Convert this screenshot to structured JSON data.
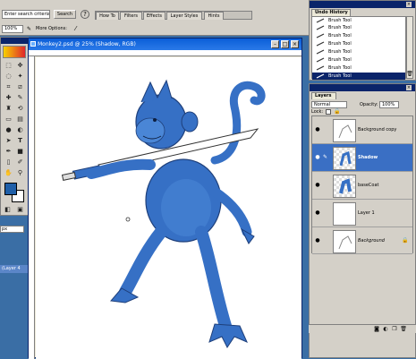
{
  "options_bar": {
    "search_placeholder": "Enter search criteria",
    "search_button": "Search",
    "more_options_label": "More Options:",
    "tabs": [
      "How To",
      "Filters",
      "Effects",
      "Layer Styles",
      "Hints"
    ],
    "zoom": "100%"
  },
  "document": {
    "title": "Monkey2.psd @ 25% (Shadow, RGB)",
    "accent_color": "#3670c5"
  },
  "undo_history": {
    "title": "Undo History",
    "items": [
      "Brush Tool",
      "Brush Tool",
      "Brush Tool",
      "Brush Tool",
      "Brush Tool",
      "Brush Tool",
      "Brush Tool",
      "Brush Tool"
    ],
    "selected_index": 7
  },
  "layers": {
    "title": "Layers",
    "blend_mode": "Normal",
    "opacity_label": "Opacity:",
    "opacity_value": "100%",
    "lock_label": "Lock:",
    "items": [
      {
        "name": "Background copy",
        "italic": false
      },
      {
        "name": "Shadow",
        "italic": false
      },
      {
        "name": "baseCoat",
        "italic": false
      },
      {
        "name": "Layer 1",
        "italic": false
      },
      {
        "name": "Background",
        "italic": true
      }
    ],
    "selected_index": 1
  },
  "left_panel": {
    "field_text": "px",
    "layer_tab_text": "(Layer 4"
  }
}
